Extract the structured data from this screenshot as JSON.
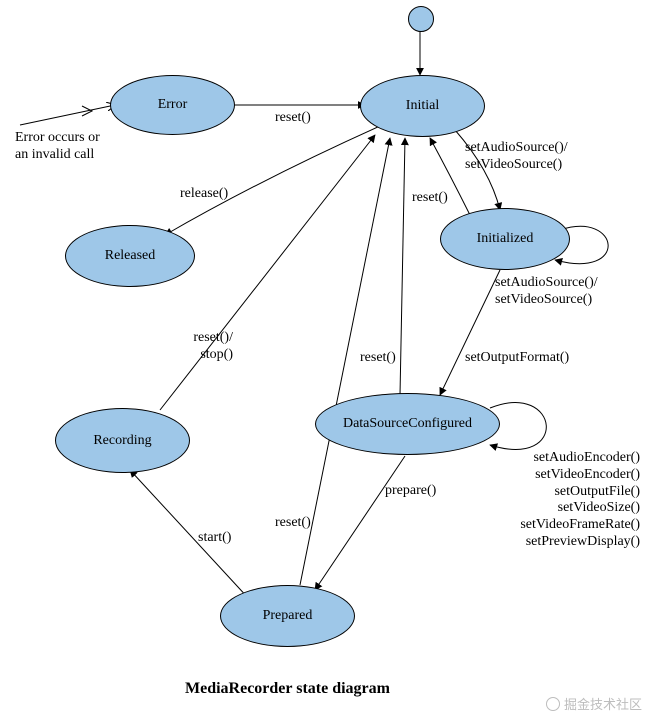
{
  "title": "MediaRecorder state diagram",
  "watermark": "掘金技术社区",
  "states": {
    "error": "Error",
    "initial": "Initial",
    "released": "Released",
    "initialized": "Initialized",
    "recording": "Recording",
    "datasource": "DataSourceConfigured",
    "prepared": "Prepared"
  },
  "labels": {
    "error_entry": "Error occurs or\nan invalid call",
    "reset_err_to_initial": "reset()",
    "release": "release()",
    "set_source_to_initialized": "setAudioSource()/\nsetVideoSource()",
    "reset_initialized_to_initial": "reset()",
    "initialized_self": "setAudioSource()/\nsetVideoSource()",
    "set_output_format": "setOutputFormat()",
    "reset_dsc_to_initial": "reset()",
    "dsc_self": "setAudioEncoder()\nsetVideoEncoder()\nsetOutputFile()\nsetVideoSize()\nsetVideoFrameRate()\nsetPreviewDisplay()",
    "prepare": "prepare()",
    "reset_prepared_to_initial": "reset()",
    "start": "start()",
    "recording_to_initial": "reset()/\nstop()"
  },
  "colors": {
    "state_fill": "#9ec7e8",
    "stroke": "#000000"
  }
}
